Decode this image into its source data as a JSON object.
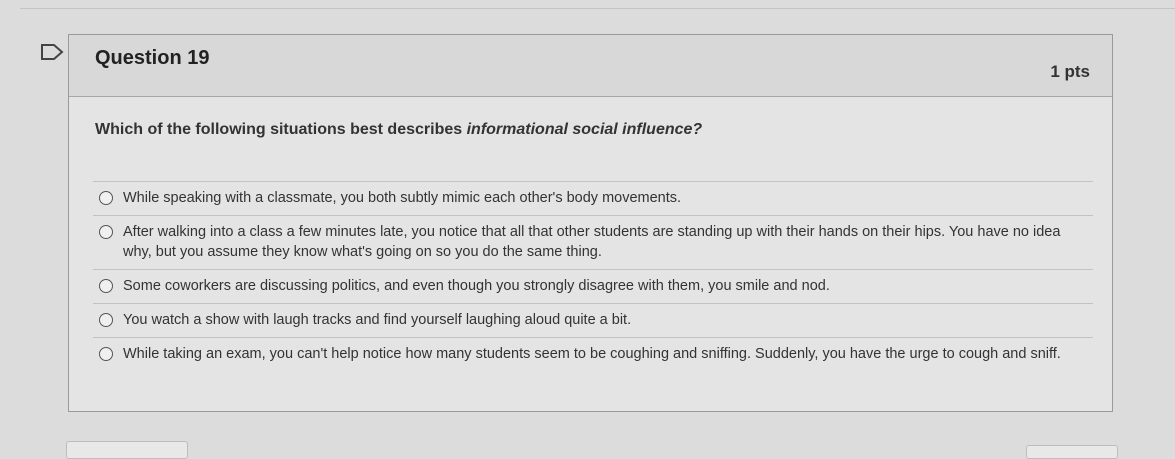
{
  "question": {
    "title": "Question 19",
    "points": "1 pts",
    "text_prefix": "Which of the following situations best describes ",
    "text_emphasis": "informational social influence?"
  },
  "answers": [
    {
      "label": "While speaking with a classmate, you both subtly mimic each other's body movements."
    },
    {
      "label": "After walking into a class a few minutes late, you notice that all that other students are standing up with their hands on their hips. You have no idea why, but you assume they know what's going on so you do the same thing."
    },
    {
      "label": "Some coworkers are discussing politics, and even though you strongly disagree with them, you smile and nod."
    },
    {
      "label": "You watch a show with laugh tracks and find yourself laughing aloud quite a bit."
    },
    {
      "label": "While taking an exam, you can't help notice how many students seem to be coughing and sniffing. Suddenly, you have the urge to cough and sniff."
    }
  ],
  "icons": {
    "flag": "flag-outline-icon"
  },
  "colors": {
    "background": "#dcdcdc",
    "header": "#d8d8d8",
    "text": "#333333"
  }
}
